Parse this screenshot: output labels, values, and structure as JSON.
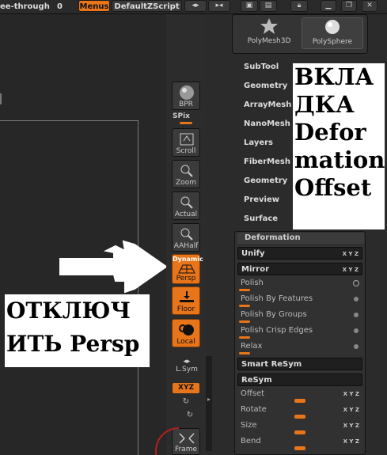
{
  "topbar": {
    "see_through_label": "ee-through",
    "see_through_value": "0",
    "menus_label": "Menus",
    "script_label": "DefaultZScript"
  },
  "palette": {
    "items": [
      {
        "label": "PolyMesh3D"
      },
      {
        "label": "PolySphere"
      }
    ]
  },
  "tool_menu": {
    "items": [
      "SubTool",
      "Geometry",
      "ArrayMesh",
      "NanoMesh",
      "Layers",
      "FiberMesh",
      "Geometry",
      "Preview",
      "Surface"
    ]
  },
  "shelf": {
    "bpr_label": "BPR",
    "spix_label": "SPix",
    "scroll_label": "Scroll",
    "zoom_label": "Zoom",
    "actual_label": "Actual",
    "aahalf_label": "AAHalf",
    "dynamic_label": "Dynamic",
    "persp_label": "Persp",
    "floor_label": "Floor",
    "local_label": "Local",
    "lsym_label": "L.Sym",
    "xyz_label": "XYZ",
    "frame_label": "Frame"
  },
  "deformation": {
    "title": "Deformation",
    "unify_label": "Unify",
    "mirror_label": "Mirror",
    "polish_label": "Polish",
    "polish_features_label": "Polish By Features",
    "polish_groups_label": "Polish By Groups",
    "polish_crisp_label": "Polish Crisp Edges",
    "relax_label": "Relax",
    "smart_resym_label": "Smart ReSym",
    "resym_label": "ReSym",
    "offset_label": "Offset",
    "rotate_label": "Rotate",
    "size_label": "Size",
    "bend_label": "Bend",
    "xyz_label": "X Y Z"
  },
  "annotations": {
    "left_line1": "ОТКЛЮЧ",
    "left_line2": "ИТЬ Persp",
    "right_line1": "ВКЛА",
    "right_line2": "ДКА",
    "right_line3": "Defor",
    "right_line4": "mation",
    "right_line5": "Offset"
  },
  "colors": {
    "accent": "#e8751a",
    "panel": "#313131",
    "background": "#2b2b2b"
  }
}
